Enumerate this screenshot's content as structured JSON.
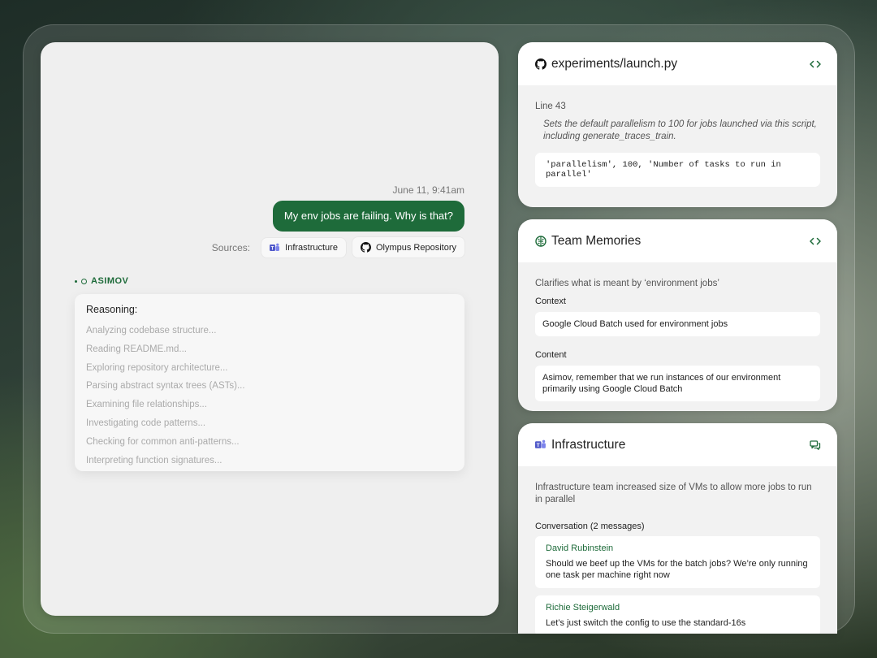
{
  "chat": {
    "timestamp": "June 11, 9:41am",
    "user_message": "My env jobs are failing. Why is that?",
    "sources_label": "Sources:",
    "sources": [
      {
        "label": "Infrastructure",
        "icon": "teams-icon"
      },
      {
        "label": "Olympus Repository",
        "icon": "github-icon"
      }
    ],
    "assistant_name": "ASIMOV",
    "reasoning_title": "Reasoning:",
    "reasoning_steps": [
      "Analyzing codebase structure...",
      "Reading README.md...",
      "Exploring repository architecture...",
      "Parsing abstract syntax trees (ASTs)...",
      "Examining file relationships...",
      "Investigating code patterns...",
      "Checking for common anti-patterns...",
      "Interpreting function signatures..."
    ]
  },
  "file_card": {
    "title": "experiments/launch.py",
    "line": "Line 43",
    "note": "Sets the default parallelism to 100 for jobs launched via this script, including generate_traces_train.",
    "code": "'parallelism', 100, 'Number of tasks to run in parallel'"
  },
  "memories_card": {
    "title": "Team Memories",
    "summary": "Clarifies what is meant by ‘environment jobs’",
    "context_label": "Context",
    "context_value": "Google Cloud Batch used for environment jobs",
    "content_label": "Content",
    "content_value": "Asimov, remember that we run instances of our environment primarily using Google Cloud Batch"
  },
  "infra_card": {
    "title": "Infrastructure",
    "summary": "Infrastructure team increased size of VMs to allow more jobs to run in parallel",
    "conversation_label": "Conversation (2 messages)",
    "messages": [
      {
        "author": "David  Rubinstein",
        "text": "Should we beef up the VMs for the batch jobs? We’re only running one task per machine right now"
      },
      {
        "author": "Richie Steigerwald",
        "text": "Let’s just switch the config to use the standard-16s"
      }
    ]
  },
  "colors": {
    "accent": "#1e6b3a",
    "panel": "#efefef",
    "card": "#f2f2f2"
  }
}
